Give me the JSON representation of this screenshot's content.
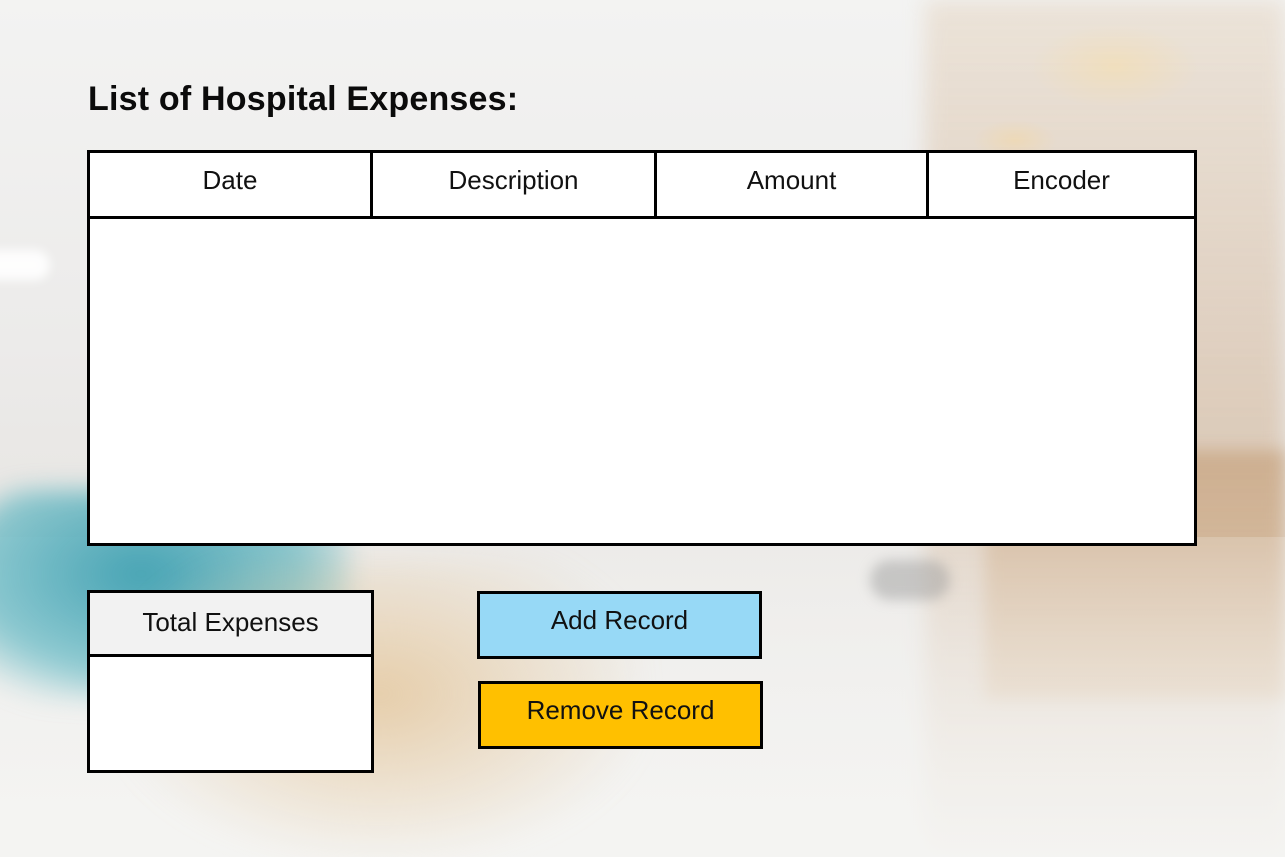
{
  "page": {
    "title": "List of Hospital Expenses:"
  },
  "table": {
    "columns": [
      "Date",
      "Description",
      "Amount",
      "Encoder"
    ],
    "rows": []
  },
  "total": {
    "label": "Total Expenses",
    "value": ""
  },
  "actions": {
    "add_label": "Add Record",
    "remove_label": "Remove Record"
  },
  "colors": {
    "add_button": "#97d9f6",
    "remove_button": "#ffc000",
    "total_header": "#f2f2f2"
  }
}
